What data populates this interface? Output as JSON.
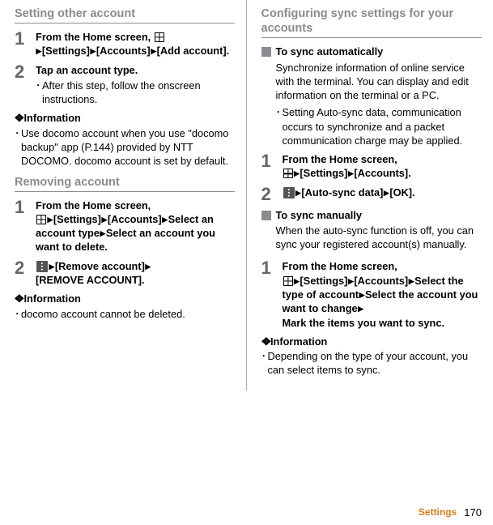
{
  "left": {
    "h1": "Setting other account",
    "s1": {
      "num": "1",
      "title_a": "From the Home screen, ",
      "title_b": "[Settings]",
      "title_c": "[Accounts]",
      "title_d": "[Add account]."
    },
    "s2": {
      "num": "2",
      "title": "Tap an account type.",
      "bullet": "After this step, follow the onscreen instructions."
    },
    "info1": {
      "heading_prefix": "❖",
      "heading": "Information",
      "bullet": "Use docomo account when you use \"docomo backup\" app (P.144) provided by NTT DOCOMO. docomo account is set by default."
    },
    "h2": "Removing account",
    "s3": {
      "num": "1",
      "title_a": "From the Home screen, ",
      "title_b": "[Settings]",
      "title_c": "[Accounts]",
      "title_d": "Select an account type",
      "title_e": "Select an account you want to delete."
    },
    "s4": {
      "num": "2",
      "title_a": "[Remove account]",
      "title_b": "[REMOVE ACCOUNT]."
    },
    "info2": {
      "heading_prefix": "❖",
      "heading": "Information",
      "bullet": "docomo account cannot be deleted."
    }
  },
  "right": {
    "h1": "Configuring sync settings for your accounts",
    "sub1": {
      "title": "To sync automatically",
      "desc": "Synchronize information of online service with the terminal. You can display and edit information on the terminal or a PC.",
      "bullet": "Setting Auto-sync data, communication occurs to synchronize and a packet communication charge may be applied."
    },
    "s1": {
      "num": "1",
      "title_a": "From the Home screen, ",
      "title_b": "[Settings]",
      "title_c": "[Accounts]."
    },
    "s2": {
      "num": "2",
      "title_a": "[Auto-sync data]",
      "title_b": "[OK]."
    },
    "sub2": {
      "title": "To sync manually",
      "desc": "When the auto-sync function is off, you can sync your registered account(s) manually."
    },
    "s3": {
      "num": "1",
      "title_a": "From the Home screen, ",
      "title_b": "[Settings]",
      "title_c": "[Accounts]",
      "title_d": "Select the type of account",
      "title_e": "Select the account you want to change",
      "title_f": "Mark the items you want to sync."
    },
    "info": {
      "heading_prefix": "❖",
      "heading": "Information",
      "bullet": "Depending on the type of your account, you can select items to sync."
    }
  },
  "footer": {
    "label": "Settings",
    "page": "170"
  }
}
